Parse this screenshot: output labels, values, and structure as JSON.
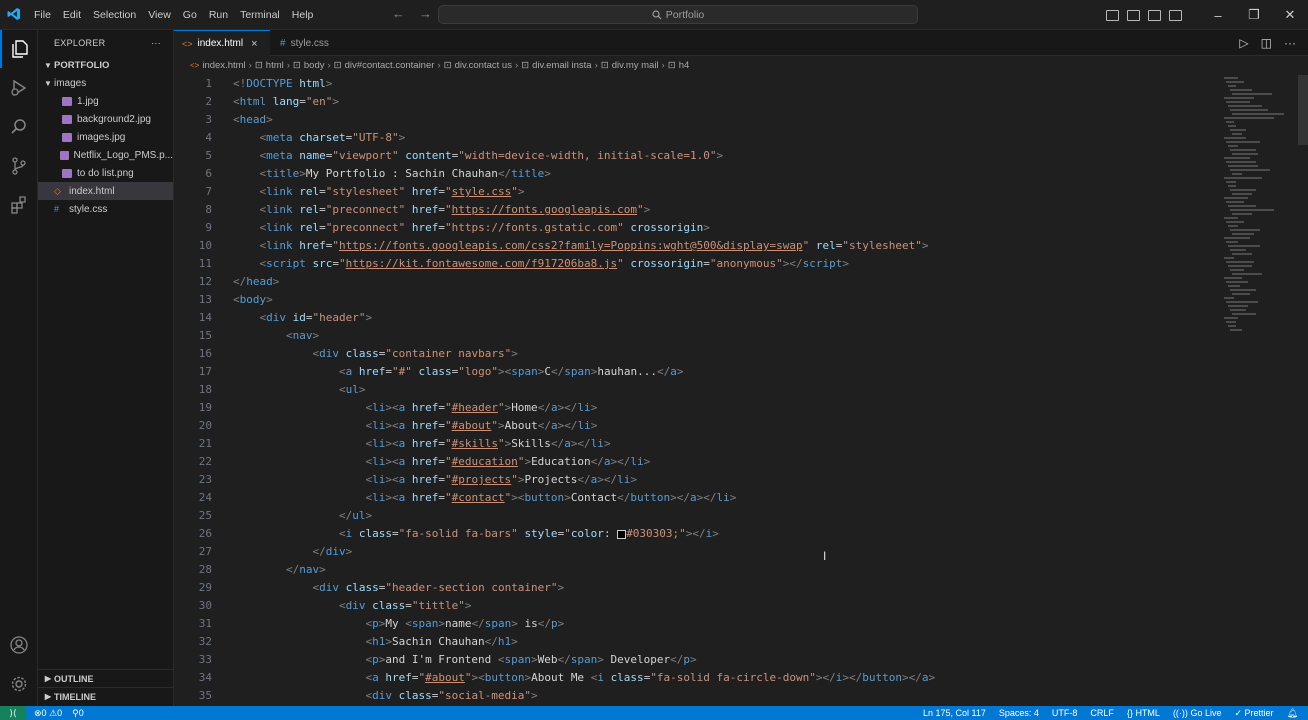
{
  "titlebar": {
    "menu": [
      "File",
      "Edit",
      "Selection",
      "View",
      "Go",
      "Run",
      "Terminal",
      "Help"
    ],
    "search_text": "Portfolio",
    "accent_color": "#0078d4"
  },
  "activity_bar": {
    "items": [
      "files-icon",
      "run-debug-icon",
      "search-icon",
      "source-control-icon",
      "extensions-icon"
    ],
    "bottom": [
      "account-icon",
      "settings-gear-icon"
    ]
  },
  "sidebar": {
    "title": "EXPLORER",
    "more": "···",
    "folder": "PORTFOLIO",
    "tree": [
      {
        "label": "images",
        "type": "folder",
        "indent": 1
      },
      {
        "label": "1.jpg",
        "type": "image",
        "indent": 2
      },
      {
        "label": "background2.jpg",
        "type": "image",
        "indent": 2
      },
      {
        "label": "images.jpg",
        "type": "image",
        "indent": 2
      },
      {
        "label": "Netflix_Logo_PMS.p...",
        "type": "image",
        "indent": 2
      },
      {
        "label": "to do list.png",
        "type": "image",
        "indent": 2
      },
      {
        "label": "index.html",
        "type": "html",
        "indent": 1,
        "selected": true
      },
      {
        "label": "style.css",
        "type": "css",
        "indent": 1
      }
    ],
    "outline": "OUTLINE",
    "timeline": "TIMELINE"
  },
  "tabs": [
    {
      "label": "index.html",
      "active": true
    },
    {
      "label": "style.css",
      "active": false
    }
  ],
  "tab_close": "×",
  "breadcrumb": [
    "index.html",
    "html",
    "body",
    "div#contact.container",
    "div.contact us",
    "div.email insta",
    "div.my mail",
    "h4"
  ],
  "code": {
    "line_numbers": [
      "1",
      "2",
      "3",
      "4",
      "5",
      "6",
      "7",
      "8",
      "9",
      "10",
      "11",
      "12",
      "13",
      "14",
      "15",
      "16",
      "17",
      "18",
      "19",
      "20",
      "21",
      "22",
      "23",
      "24",
      "25",
      "26",
      "27",
      "28",
      "29",
      "30",
      "31",
      "32",
      "33",
      "34",
      "35"
    ]
  },
  "status": {
    "errors": "0",
    "warnings": "0",
    "ports": "0",
    "position": "Ln 175, Col 117",
    "spaces": "Spaces: 4",
    "encoding": "UTF-8",
    "eol": "CRLF",
    "language": "HTML",
    "golive": "Go Live",
    "prettier": "Prettier"
  }
}
